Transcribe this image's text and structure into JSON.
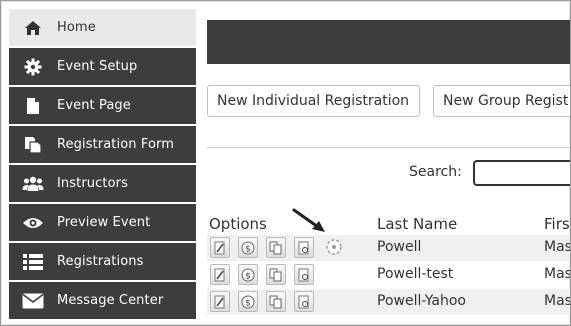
{
  "sidebar": {
    "items": [
      {
        "label": "Home",
        "icon": "home-icon",
        "active": true
      },
      {
        "label": "Event Setup",
        "icon": "gear-icon",
        "active": false
      },
      {
        "label": "Event Page",
        "icon": "document-icon",
        "active": false
      },
      {
        "label": "Registration Form",
        "icon": "form-copy-icon",
        "active": false
      },
      {
        "label": "Instructors",
        "icon": "users-icon",
        "active": false
      },
      {
        "label": "Preview Event",
        "icon": "eye-icon",
        "active": false
      },
      {
        "label": "Registrations",
        "icon": "list-icon",
        "active": false
      },
      {
        "label": "Message Center",
        "icon": "envelope-icon",
        "active": false
      }
    ]
  },
  "actions": {
    "new_individual": "New Individual Registration",
    "new_group": "New Group Regist"
  },
  "search": {
    "label": "Search:",
    "value": ""
  },
  "table": {
    "headers": {
      "options": "Options",
      "last_name": "Last Name",
      "first_name": "Firs"
    },
    "rows": [
      {
        "last_name": "Powell",
        "first_name": "Mas",
        "has_extra_icon": true
      },
      {
        "last_name": "Powell-test",
        "first_name": "Mas",
        "has_extra_icon": false
      },
      {
        "last_name": "Powell-Yahoo",
        "first_name": "Mas",
        "has_extra_icon": false
      }
    ]
  },
  "colors": {
    "sidebar_bg": "#3d3d3d",
    "sidebar_active_bg": "#e9e9e9",
    "topbar_bg": "#3d3d3d"
  }
}
